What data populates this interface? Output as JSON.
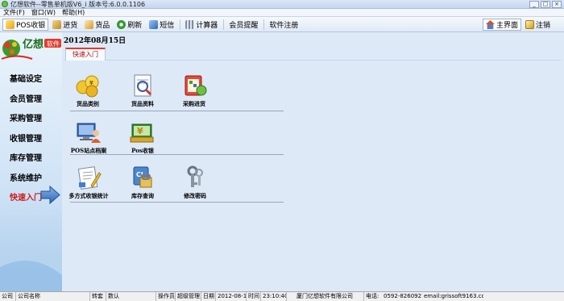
{
  "window": {
    "title": "亿想软件--零售单机版V6_i  版本号:6.0.0.1106",
    "controls": [
      "_",
      "□",
      "×"
    ]
  },
  "menu": [
    "文件(F)",
    "窗口(W)",
    "帮助(H)"
  ],
  "toolbar": {
    "left": [
      {
        "label": "POS收银",
        "icon": "pos-cashier-icon",
        "color": "#e8b020"
      },
      {
        "label": "进货",
        "icon": "purchase-icon",
        "color": "#d9a530"
      },
      {
        "label": "货品",
        "icon": "goods-icon",
        "color": "#e0b04a"
      },
      {
        "label": "刷新",
        "icon": "refresh-icon",
        "color": "#3aa63a"
      },
      {
        "label": "短信",
        "icon": "sms-icon",
        "color": "#3e7ad0"
      },
      {
        "label": "计算器",
        "icon": "calculator-icon",
        "color": "#8a96a8"
      },
      {
        "label": "会员提醒",
        "icon": "",
        "color": ""
      },
      {
        "label": "软件注册",
        "icon": "",
        "color": ""
      }
    ],
    "right": [
      {
        "label": "主界面",
        "icon": "home-icon",
        "color": "#d5532b"
      },
      {
        "label": "注销",
        "icon": "logout-icon",
        "color": "#d6b32e"
      }
    ]
  },
  "logo": {
    "brand": "亿想",
    "suffix": "软件"
  },
  "sidebar": {
    "items": [
      {
        "label": "基础设定",
        "active": false
      },
      {
        "label": "会员管理",
        "active": false
      },
      {
        "label": "采购管理",
        "active": false
      },
      {
        "label": "收银管理",
        "active": false
      },
      {
        "label": "库存管理",
        "active": false
      },
      {
        "label": "系统维护",
        "active": false
      },
      {
        "label": "快速入门",
        "active": true
      }
    ]
  },
  "content": {
    "date": "2012年08月15日",
    "tab": "快速入门",
    "groups": [
      [
        {
          "label": "货品类别",
          "icon": "goods-category-icon"
        },
        {
          "label": "货品资料",
          "icon": "goods-info-icon"
        },
        {
          "label": "采购进货",
          "icon": "purchase-stock-icon"
        }
      ],
      [
        {
          "label": "POS站点档案",
          "icon": "pos-station-icon"
        },
        {
          "label": "Pos收银",
          "icon": "pos-register-icon"
        }
      ],
      [
        {
          "label": "多方式收银统计",
          "icon": "payment-stats-icon"
        },
        {
          "label": "库存查询",
          "icon": "inventory-query-icon"
        },
        {
          "label": "修改密码",
          "icon": "keys-icon"
        }
      ]
    ]
  },
  "statusbar": {
    "company_label": "公司",
    "company_value": "公司名称",
    "store_label": "转套",
    "store_value": "数认",
    "operator_label": "操作员",
    "operator_value": "超级管理员",
    "date_label": "日期",
    "date_value": "2012-08-15",
    "time_label": "时间",
    "time_value": "23:10:40",
    "vendor": "厦门亿想软件有限公司",
    "phone_label": "电话:",
    "phone_value": "0592-8260921",
    "email": "email:grissoft9163.com"
  }
}
